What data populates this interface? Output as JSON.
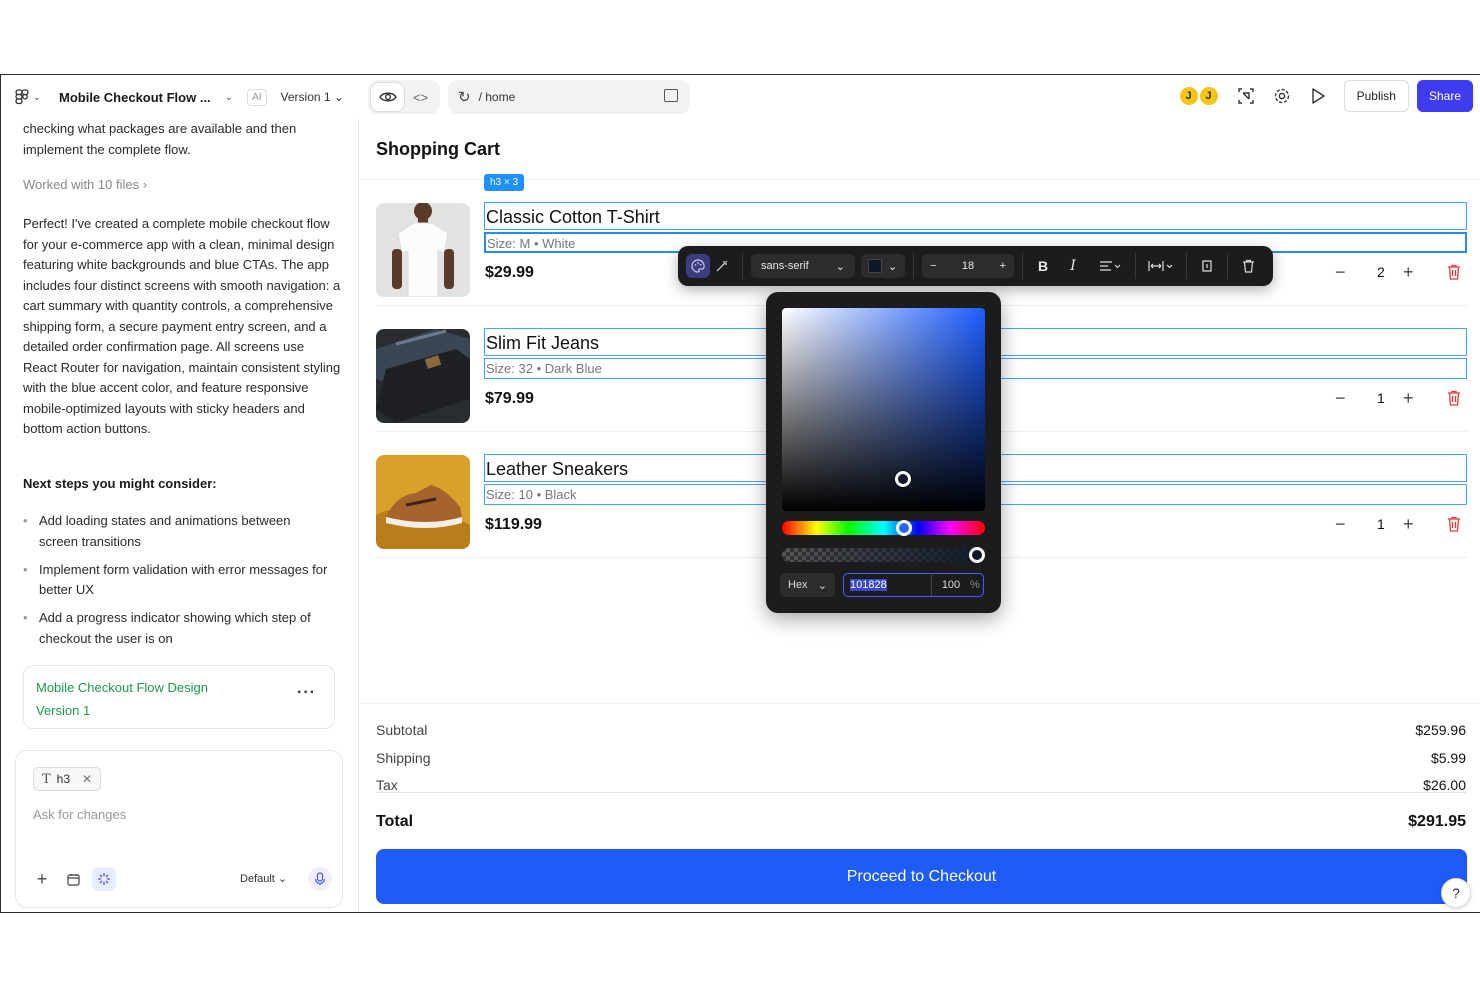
{
  "header": {
    "project_title": "Mobile Checkout Flow ...",
    "ai_badge": "AI",
    "version": "Version 1",
    "url_path": "/ home",
    "avatars": [
      "J",
      "J"
    ],
    "publish_label": "Publish",
    "share_label": "Share",
    "accent": "#3d3cf0"
  },
  "chat": {
    "intro_text": "checking what packages are available and then implement the complete flow.",
    "worked_with": "Worked with 10 files",
    "response": "Perfect! I've created a complete mobile checkout flow for your e-commerce app with a clean, minimal design featuring white backgrounds and blue CTAs. The app includes four distinct screens with smooth navigation: a cart summary with quantity controls, a comprehensive shipping form, a secure payment entry screen, and a detailed order confirmation page. All screens use React Router for navigation, maintain consistent styling with the blue accent color, and feature responsive mobile-optimized layouts with sticky headers and bottom action buttons.",
    "next_steps_heading": "Next steps you might consider:",
    "next_steps": [
      "Add loading states and animations between screen transitions",
      "Implement form validation with error messages for better UX",
      "Add a progress indicator showing which step of checkout the user is on"
    ],
    "version_card": {
      "title": "Mobile Checkout Flow Design",
      "version": "Version 1"
    },
    "composer": {
      "chip": "h3",
      "placeholder": "Ask for changes",
      "mode": "Default"
    }
  },
  "preview": {
    "title": "Shopping Cart",
    "selection_tag": "h3 × 3",
    "items": [
      {
        "name": "Classic Cotton T-Shirt",
        "size": "Size: M • White",
        "price": "$29.99",
        "qty": "2"
      },
      {
        "name": "Slim Fit Jeans",
        "size": "Size: 32 • Dark Blue",
        "price": "$79.99",
        "qty": "1"
      },
      {
        "name": "Leather Sneakers",
        "size": "Size: 10 • Black",
        "price": "$119.99",
        "qty": "1"
      }
    ],
    "summary": {
      "subtotal_label": "Subtotal",
      "subtotal": "$259.96",
      "shipping_label": "Shipping",
      "shipping": "$5.99",
      "tax_label": "Tax",
      "tax": "$26.00",
      "total_label": "Total",
      "total": "$291.95"
    },
    "checkout_label": "Proceed to Checkout",
    "help_label": "?",
    "cta_color": "#1f5cf5"
  },
  "toolbar": {
    "font": "sans-serif",
    "font_size": "18",
    "bold": "B",
    "italic": "I"
  },
  "color_picker": {
    "format": "Hex",
    "hex_value": "101828",
    "alpha": "100",
    "alpha_unit": "%",
    "color": "#101828"
  }
}
